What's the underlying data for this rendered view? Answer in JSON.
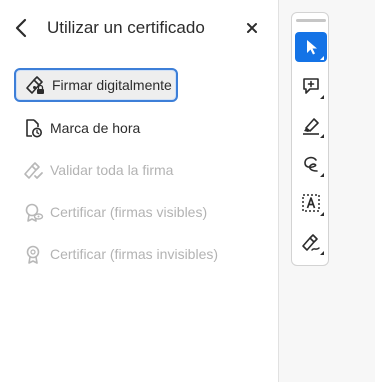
{
  "panel": {
    "title": "Utilizar un certificado",
    "back_icon": "chevron-left-icon",
    "close_icon": "close-icon",
    "items": [
      {
        "label": "Firmar digitalmente",
        "icon": "pen-sign-icon",
        "state": "selected"
      },
      {
        "label": "Marca de hora",
        "icon": "timestamp-document-icon",
        "state": "enabled"
      },
      {
        "label": "Validar toda la firma",
        "icon": "validate-signature-icon",
        "state": "disabled"
      },
      {
        "label": "Certificar (firmas visibles)",
        "icon": "certify-visible-icon",
        "state": "disabled"
      },
      {
        "label": "Certificar (firmas invisibles)",
        "icon": "certify-invisible-icon",
        "state": "disabled"
      }
    ]
  },
  "toolbar": {
    "tools": [
      {
        "name": "select-tool",
        "icon": "cursor-arrow-icon",
        "active": true
      },
      {
        "name": "add-comment-tool",
        "icon": "comment-plus-icon",
        "active": false
      },
      {
        "name": "highlight-tool",
        "icon": "marker-icon",
        "active": false
      },
      {
        "name": "draw-tool",
        "icon": "freehand-draw-icon",
        "active": false
      },
      {
        "name": "text-recognition-tool",
        "icon": "text-select-box-icon",
        "active": false
      },
      {
        "name": "sign-tool",
        "icon": "pen-sign-icon",
        "active": false
      }
    ]
  },
  "colors": {
    "accent": "#1473e6",
    "selected_border": "#3d7fd8",
    "disabled_text": "#b3b3b3",
    "text": "#2c2c2c"
  }
}
